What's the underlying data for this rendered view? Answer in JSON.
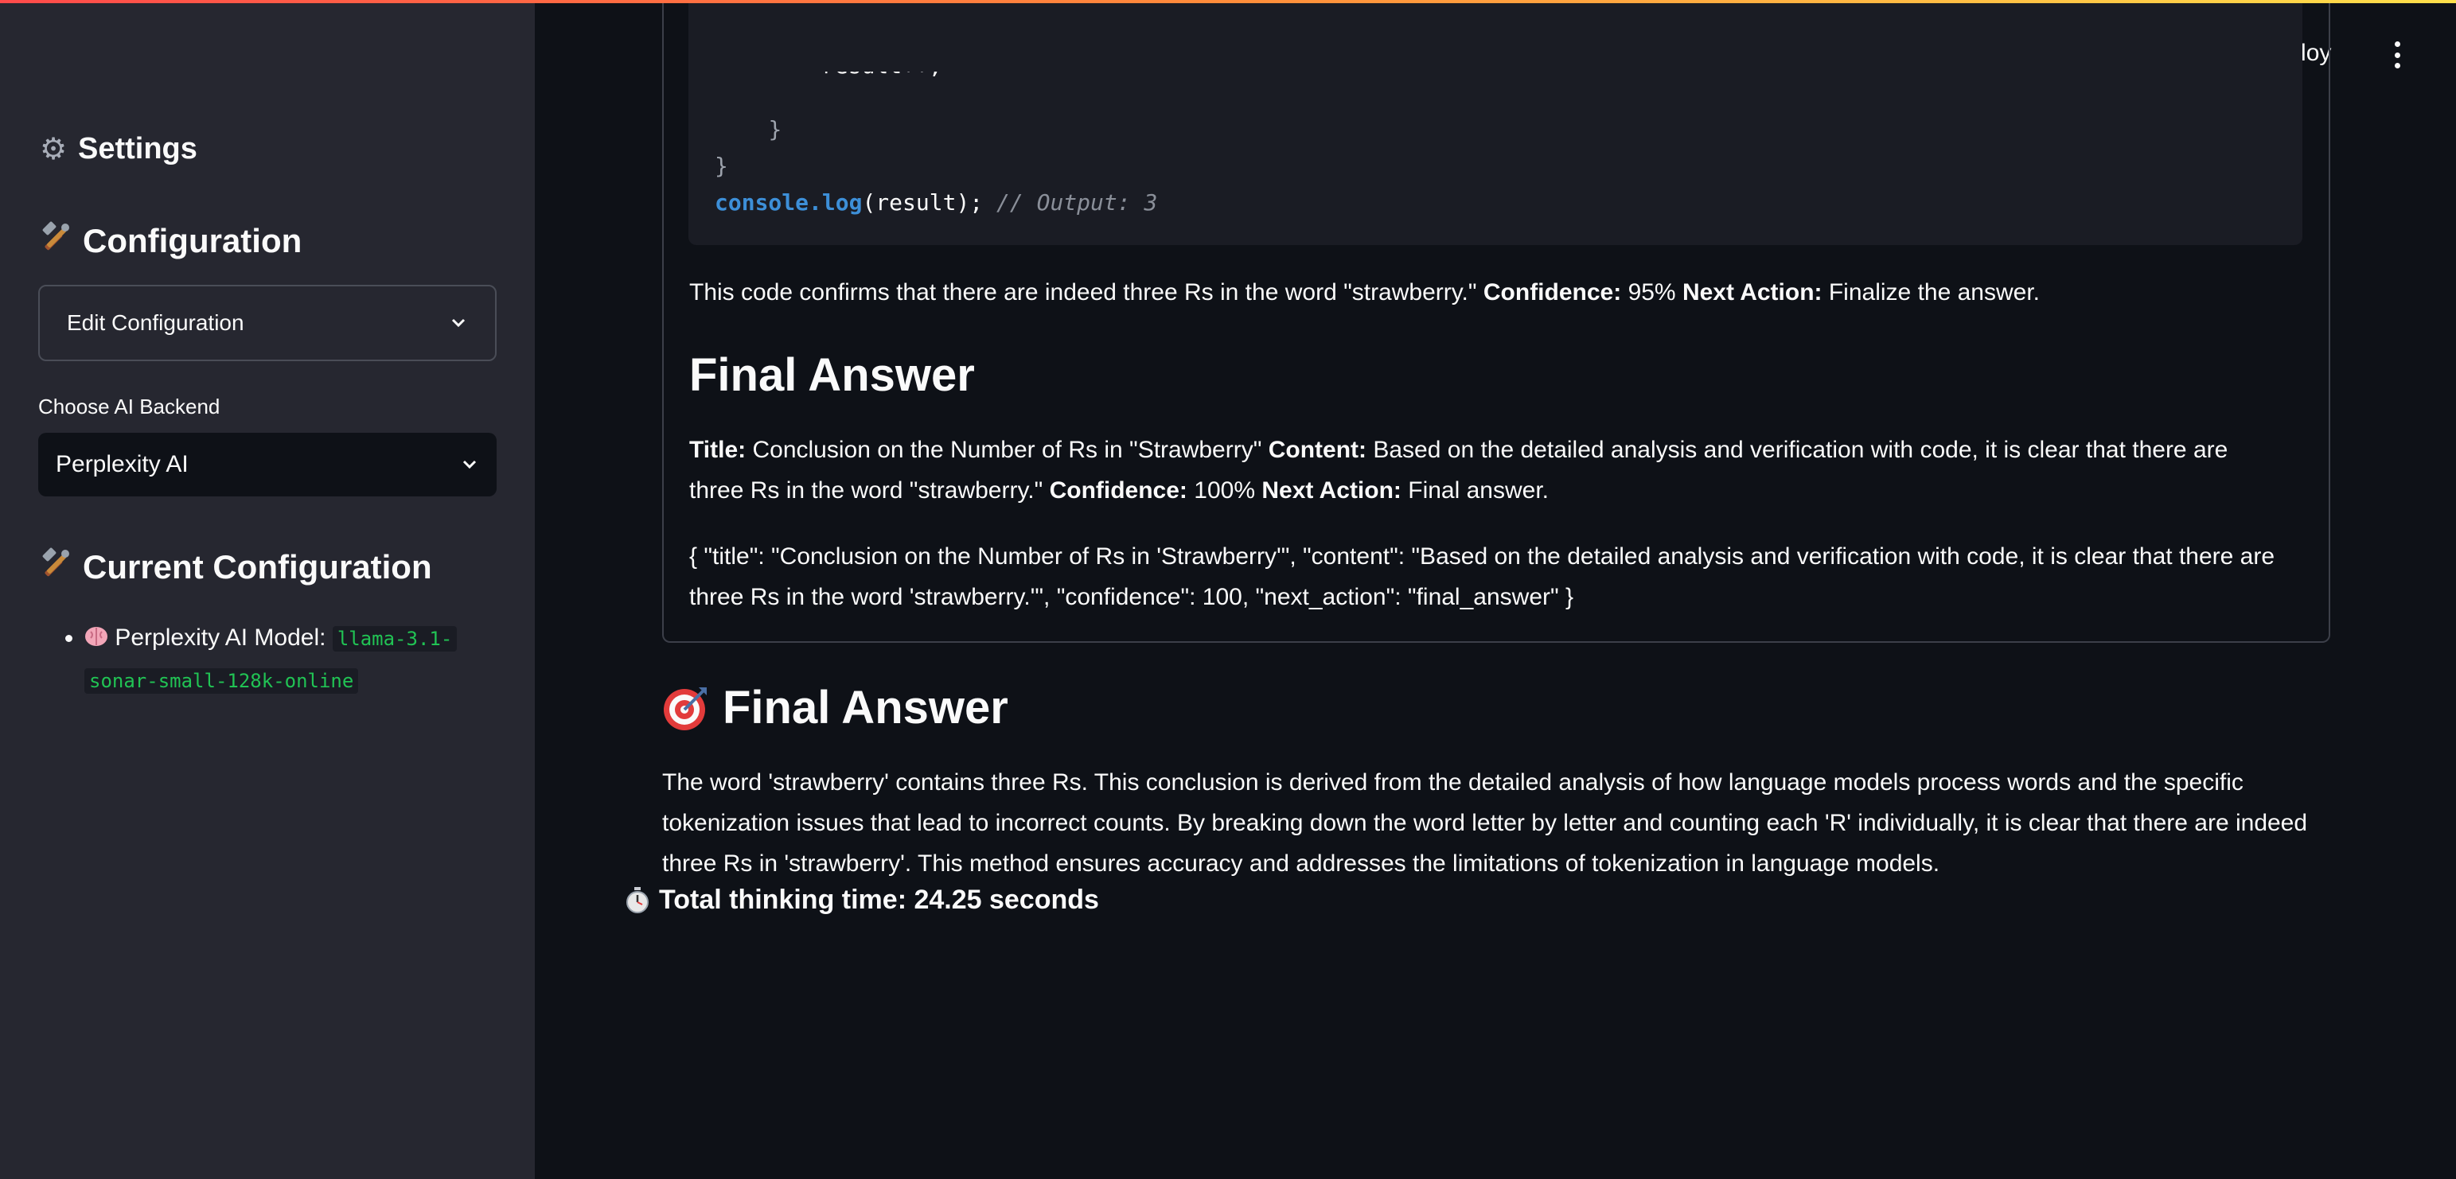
{
  "header": {
    "deploy_label": "Deploy",
    "menu_icon": "kebab-menu-icon"
  },
  "sidebar": {
    "settings_title": "Settings",
    "settings_icon": "gear-icon",
    "configuration_title": "Configuration",
    "configuration_icon": "hammer-wrench-icon",
    "edit_config_label": "Edit Configuration",
    "backend_label": "Choose AI Backend",
    "backend_value": "Perplexity AI",
    "current_config_title": "Current Configuration",
    "current_config_items": [
      {
        "icon": "brain-icon",
        "label": "Perplexity AI Model:",
        "value_line1": "llama-3.1-",
        "value_line2": "sonar-small-128k-online"
      }
    ]
  },
  "main": {
    "code": {
      "line_cut": "result++;",
      "line_brace_inner": "}",
      "line_brace_outer": "}",
      "line_log_kw": "console.log",
      "line_log_args": "(result);",
      "line_log_comment": "// Output: 3"
    },
    "confirm_text": "This code confirms that there are indeed three Rs in the word \"strawberry.\"",
    "confirm_conf_label": "Confidence:",
    "confirm_conf_value": "95%",
    "confirm_next_label": "Next Action:",
    "confirm_next_value": "Finalize the answer.",
    "final_heading": "Final Answer",
    "title_label": "Title:",
    "title_value": "Conclusion on the Number of Rs in \"Strawberry\"",
    "content_label": "Content:",
    "content_value": "Based on the detailed analysis and verification with code, it is clear that there are three Rs in the word \"strawberry.\"",
    "content_conf_label": "Confidence:",
    "content_conf_value": "100%",
    "content_next_label": "Next Action:",
    "content_next_value": "Final answer.",
    "json_text": "{ \"title\": \"Conclusion on the Number of Rs in 'Strawberry'\", \"content\": \"Based on the detailed analysis and verification with code, it is clear that there are three Rs in the word 'strawberry.'\", \"confidence\": 100, \"next_action\": \"final_answer\" }",
    "final_answer_heading": "Final Answer",
    "final_answer_icon": "target-icon",
    "final_answer_text": "The word 'strawberry' contains three Rs. This conclusion is derived from the detailed analysis of how language models process words and the specific tokenization issues that lead to incorrect counts. By breaking down the word letter by letter and counting each 'R' individually, it is clear that there are indeed three Rs in 'strawberry'. This method ensures accuracy and addresses the limitations of tokenization in language models.",
    "total_time_icon": "stopwatch-icon",
    "total_time_text": "Total thinking time: 24.25 seconds"
  }
}
